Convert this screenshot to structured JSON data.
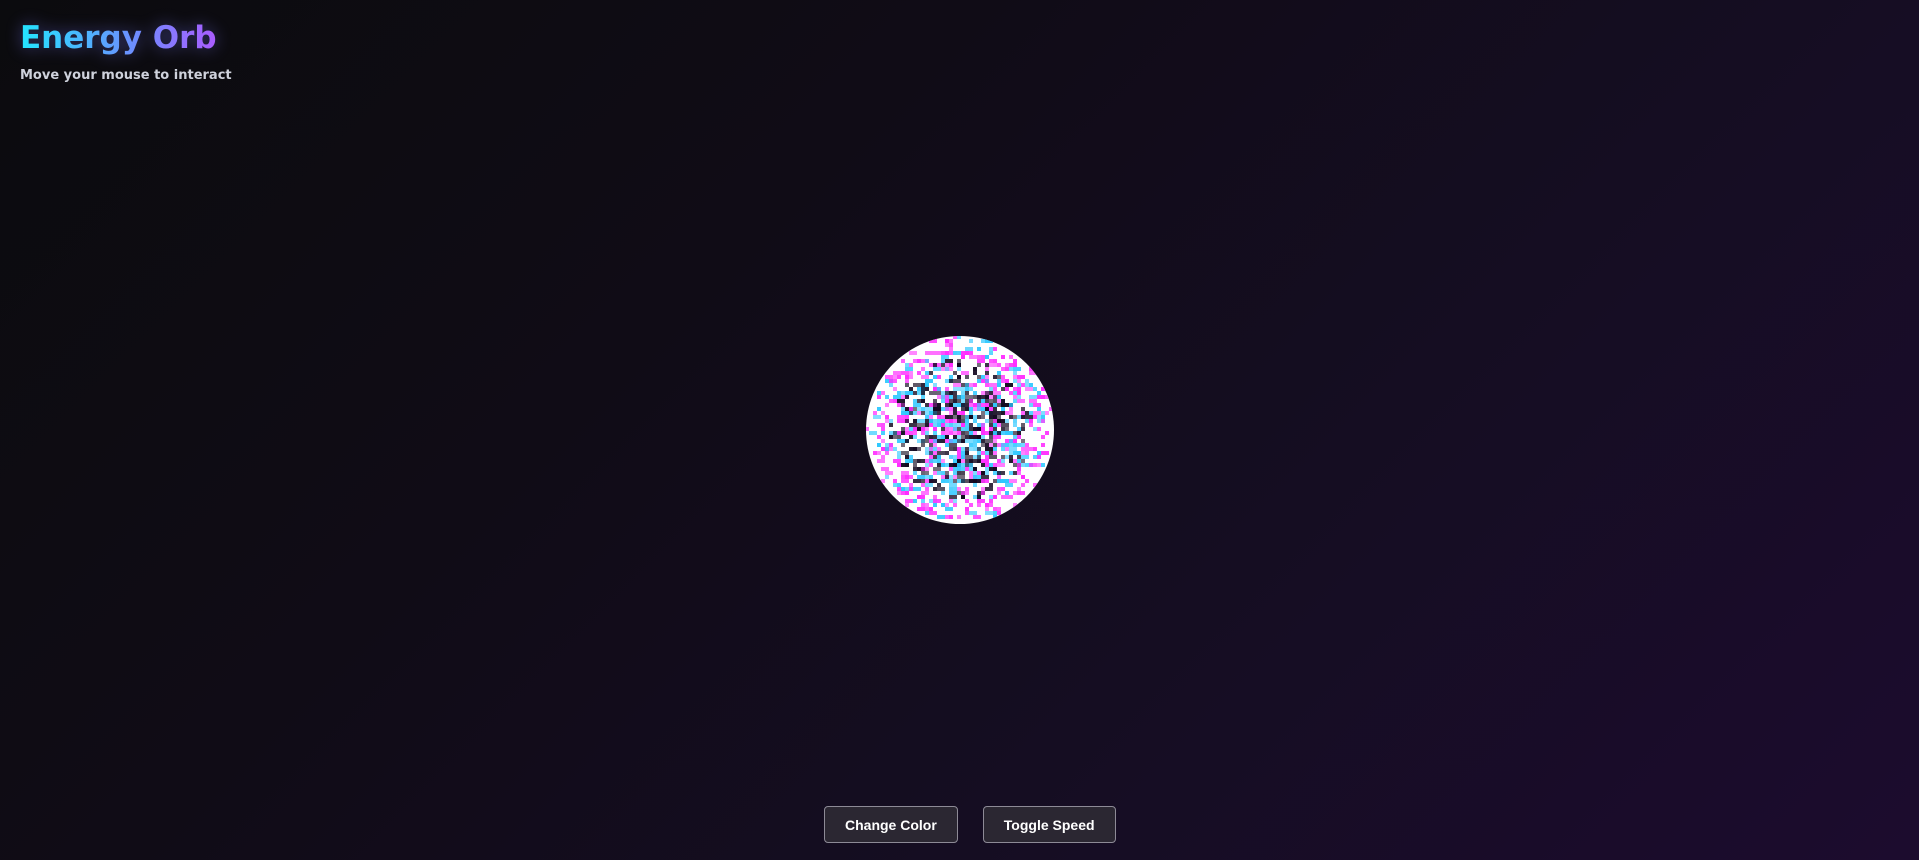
{
  "header": {
    "title": "Energy Orb",
    "subtitle": "Move your mouse to interact"
  },
  "controls": {
    "change_color_label": "Change Color",
    "toggle_speed_label": "Toggle Speed"
  },
  "theme": {
    "background_start": "#0b0b0e",
    "background_end": "#1c0c2e",
    "title_gradient_start": "#22e5ff",
    "title_gradient_end": "#b553ff",
    "orb_colors": [
      "#ffffff",
      "#ff2bff",
      "#2ec8ff",
      "#12081f"
    ]
  }
}
